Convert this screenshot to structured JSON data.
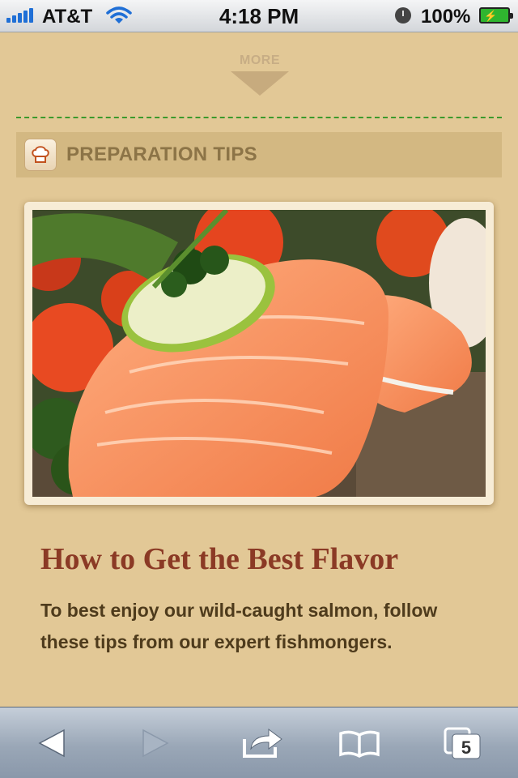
{
  "status_bar": {
    "carrier": "AT&T",
    "time": "4:18 PM",
    "battery_percent": "100%",
    "signal_bars": 5,
    "battery_level": 1.0,
    "battery_color": "#2fb52f"
  },
  "content": {
    "more_label": "MORE",
    "section_title": "PREPARATION TIPS",
    "section_icon": "chef-hat-icon",
    "image_description_icon": "salmon-photo",
    "article_title": "How to Get the Best Flavor",
    "article_body": "To best enjoy our wild-caught salmon, follow these tips from our expert fishmongers."
  },
  "toolbar": {
    "back_icon": "back-arrow-icon",
    "forward_icon": "forward-arrow-icon",
    "share_icon": "share-icon",
    "bookmarks_icon": "bookmarks-icon",
    "tabs_icon": "tabs-icon",
    "tabs_count": "5"
  },
  "colors": {
    "page_background": "#e2c896",
    "header_band": "#d3b882",
    "title_color": "#8b3a25",
    "body_text": "#4e3b1c",
    "dotted_rule": "#3c9a2c"
  }
}
